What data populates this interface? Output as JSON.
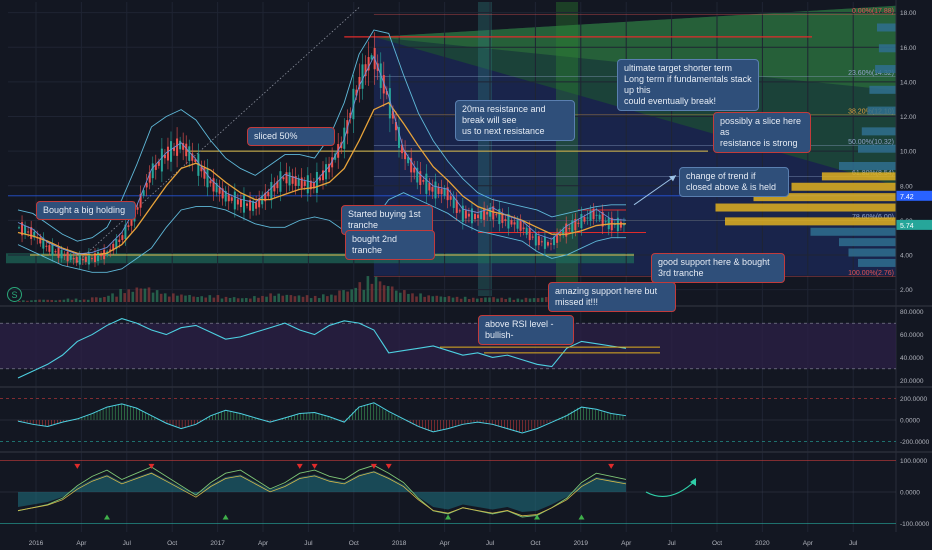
{
  "chart_data": [
    {
      "type": "line",
      "panel": "price",
      "title": "",
      "x_ticks": [
        "2016",
        "Apr",
        "Jul",
        "Oct",
        "2017",
        "Apr",
        "Jul",
        "Oct",
        "2018",
        "Apr",
        "Jul",
        "Oct",
        "2019",
        "Apr",
        "Jul",
        "Oct",
        "2020",
        "Apr",
        "Jul"
      ],
      "y_ticks": [
        2.0,
        4.0,
        6.0,
        8.0,
        10.0,
        12.0,
        14.0,
        16.0,
        18.0
      ],
      "ylim": [
        1.4,
        18.5
      ],
      "price_tags": [
        {
          "value": "7.42",
          "color": "#2962ff"
        },
        {
          "value": "5.74",
          "color": "#26a69a"
        }
      ],
      "fib_levels": [
        {
          "label": "0.00%(17.88)",
          "value": 17.88,
          "color": "#e05252"
        },
        {
          "label": "23.60%(14.32)",
          "value": 14.32,
          "color": "#8fa3c8"
        },
        {
          "label": "38.20%(12.10)",
          "value": 12.1,
          "color": "#e0a040"
        },
        {
          "label": "50.00%(10.32)",
          "value": 10.32,
          "color": "#8fa3c8"
        },
        {
          "label": "61.80%(8.54)",
          "value": 8.54,
          "color": "#8fa3c8"
        },
        {
          "label": "78.60%(6.00)",
          "value": 6.0,
          "color": "#8fa3c8"
        },
        {
          "label": "100.00%(2.76)",
          "value": 2.76,
          "color": "#e05252"
        }
      ],
      "series": [
        {
          "values": [
            5.6,
            5.2,
            4.4,
            4.0,
            3.7,
            3.8,
            4.1,
            5.0,
            6.6,
            8.8,
            9.8,
            10.4,
            9.4,
            8.2,
            7.4,
            7.0,
            6.8,
            7.6,
            8.5,
            8.2,
            8.0,
            9.0,
            10.6,
            13.8,
            15.6,
            13.2,
            10.0,
            8.6,
            7.8,
            7.6,
            6.4,
            6.2,
            6.5,
            6.0,
            5.7,
            4.9,
            4.6,
            5.4,
            5.9,
            6.4,
            5.8,
            5.74
          ]
        }
      ],
      "ma_values": [
        5.3,
        5.1,
        4.8,
        4.4,
        4.1,
        4.0,
        4.1,
        4.6,
        5.6,
        6.8,
        8.0,
        9.0,
        9.3,
        8.9,
        8.2,
        7.6,
        7.2,
        7.2,
        7.5,
        7.8,
        7.9,
        8.2,
        9.0,
        10.6,
        12.4,
        12.8,
        11.6,
        10.3,
        9.1,
        8.3,
        7.4,
        6.8,
        6.5,
        6.3,
        6.0,
        5.6,
        5.2,
        5.2,
        5.4,
        5.7,
        5.8,
        5.8
      ],
      "bb_upper": [
        6.6,
        6.4,
        5.8,
        5.2,
        4.8,
        5.0,
        5.6,
        7.2,
        9.2,
        11.4,
        12.0,
        12.4,
        11.8,
        10.6,
        9.6,
        9.0,
        8.6,
        9.2,
        9.8,
        9.8,
        9.6,
        10.8,
        12.8,
        15.6,
        17.0,
        16.8,
        14.4,
        12.2,
        10.6,
        9.4,
        8.4,
        7.6,
        7.2,
        7.0,
        6.8,
        6.6,
        6.2,
        6.4,
        6.6,
        6.8,
        6.9,
        6.9
      ],
      "bb_lower": [
        4.6,
        4.2,
        3.8,
        3.4,
        3.2,
        3.0,
        3.0,
        3.2,
        3.8,
        4.4,
        5.6,
        6.6,
        6.8,
        6.8,
        6.6,
        6.2,
        5.8,
        5.6,
        5.6,
        6.0,
        6.2,
        6.0,
        5.4,
        5.2,
        6.0,
        7.2,
        7.6,
        7.2,
        6.8,
        6.4,
        5.8,
        5.4,
        5.2,
        5.0,
        4.8,
        4.2,
        3.8,
        4.0,
        4.4,
        4.8,
        5.0,
        5.0
      ],
      "horizontal_levels": [
        16.6,
        10.0,
        7.42,
        4.0
      ],
      "volume_pattern": [
        4,
        6,
        5,
        8,
        6,
        12,
        20,
        30,
        36,
        28,
        20,
        18,
        14,
        16,
        12,
        10,
        14,
        20,
        18,
        16,
        14,
        18,
        30,
        46,
        60,
        42,
        28,
        20,
        16,
        14,
        12,
        10,
        12,
        10,
        8,
        10,
        12,
        8,
        6,
        6,
        5,
        4
      ],
      "annotations": [
        "Bought a big holding",
        "sliced 50%",
        "Started buying 1st tranche",
        "bought 2nd tranche",
        "20ma resistance and break will see\nus to next resistance",
        "ultimate target shorter term\nLong term if fundamentals stack up this\ncould eventually break!",
        "possibly a slice here as\nresistance is strong",
        "change of trend if closed above & is held",
        "good support here & bought 3rd tranche",
        "amazing support here but missed it!!!"
      ]
    },
    {
      "type": "line",
      "panel": "rsi",
      "y_ticks": [
        "80.0000",
        "60.0000",
        "40.0000",
        "20.0000"
      ],
      "ylim": [
        15,
        85
      ],
      "annotation": "above RSI level - bullish-",
      "values": [
        22,
        28,
        34,
        42,
        54,
        60,
        68,
        74,
        70,
        64,
        60,
        66,
        68,
        62,
        56,
        58,
        62,
        66,
        70,
        64,
        60,
        68,
        72,
        70,
        64,
        44,
        46,
        48,
        50,
        46,
        42,
        44,
        40,
        42,
        38,
        34,
        32,
        48,
        54,
        52,
        50,
        48
      ]
    },
    {
      "type": "line",
      "panel": "oscillator",
      "y_ticks": [
        "200.0000",
        "0.0000",
        "-200.0000"
      ],
      "ylim": [
        -260,
        260
      ],
      "values": [
        -10,
        -40,
        -60,
        -20,
        10,
        60,
        120,
        150,
        110,
        40,
        -30,
        -80,
        -40,
        40,
        90,
        60,
        20,
        -20,
        20,
        60,
        70,
        30,
        -20,
        120,
        160,
        80,
        10,
        -60,
        -110,
        -80,
        -40,
        -20,
        -40,
        -80,
        -120,
        -80,
        -20,
        40,
        120,
        100,
        60,
        40
      ]
    },
    {
      "type": "line",
      "panel": "wave",
      "y_ticks": [
        "100.0000",
        "0.0000",
        "-100.0000"
      ],
      "ylim": [
        -115,
        115
      ],
      "values": [
        -60,
        -50,
        -40,
        -20,
        20,
        50,
        70,
        40,
        60,
        80,
        50,
        20,
        -10,
        30,
        60,
        70,
        40,
        10,
        30,
        60,
        70,
        50,
        40,
        70,
        85,
        60,
        30,
        -20,
        -60,
        -70,
        -50,
        -60,
        -70,
        -60,
        -80,
        -75,
        -50,
        -20,
        30,
        60,
        50,
        40
      ]
    }
  ]
}
